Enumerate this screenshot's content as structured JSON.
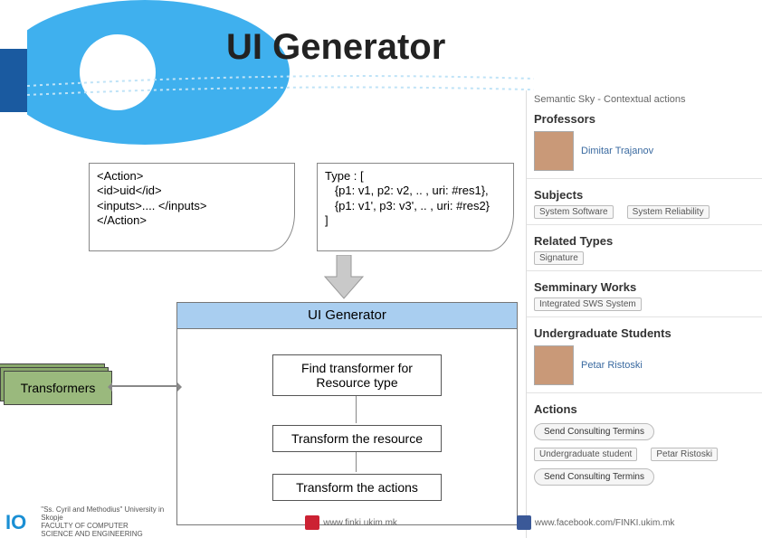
{
  "title": "UI Generator",
  "code_left": "<Action>\n<id>uid</id>\n<inputs>.... </inputs>\n</Action>",
  "code_right": "Type : [\n   {p1: v1, p2: v2, .. , uri: #res1},\n   {p1: v1', p3: v3', .. , uri: #res2}\n]",
  "uigen": {
    "title": "UI Generator",
    "step1": "Find transformer for Resource type",
    "step2": "Transform the resource",
    "step3": "Transform the actions"
  },
  "transformers_label": "Transformers",
  "panel": {
    "app": "Semantic Sky - Contextual actions",
    "sections": {
      "professors": {
        "h": "Professors",
        "name": "Dimitar Trajanov"
      },
      "subjects": {
        "h": "Subjects",
        "tags": [
          "System Software",
          "System Reliability"
        ]
      },
      "related": {
        "h": "Related Types",
        "tags": [
          "Signature"
        ]
      },
      "seminary": {
        "h": "Semminary Works",
        "tags": [
          "Integrated SWS System"
        ]
      },
      "undergrad": {
        "h": "Undergraduate Students",
        "name": "Petar Ristoski"
      },
      "actions": {
        "h": "Actions",
        "btn1": "Send Consulting Termins",
        "tag1": "Undergraduate student",
        "tag2": "Petar Ristoski",
        "btn2": "Send Consulting Termins"
      }
    }
  },
  "footer": {
    "faculty_line1": "\"Ss. Cyril and Methodius\" University in Skopje",
    "faculty_line2": "FACULTY OF COMPUTER",
    "faculty_line3": "SCIENCE AND ENGINEERING",
    "link_web": "www.finki.ukim.mk",
    "link_fb": "www.facebook.com/FINKI.ukim.mk"
  }
}
